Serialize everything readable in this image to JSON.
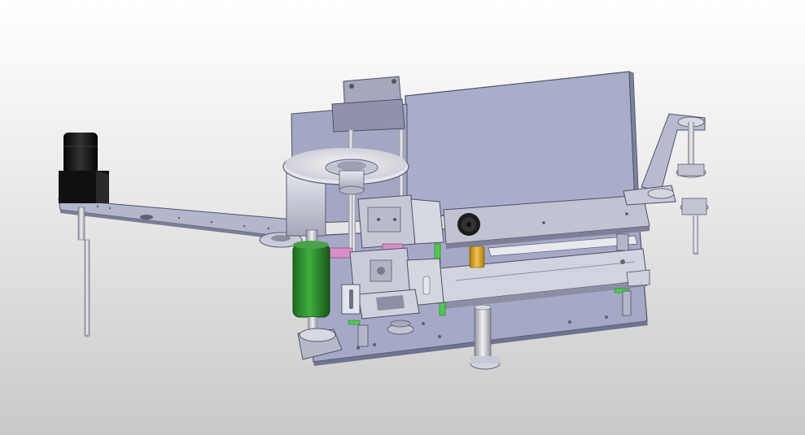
{
  "viewport": {
    "background_top": "#ffffff",
    "background_bottom": "#c9c9c9"
  },
  "model": {
    "colors": {
      "plate": "#a9adc9",
      "plate_edge": "#5b5f78",
      "metal": "#c7c9d6",
      "metal_dark": "#8a8da0",
      "steel": "#dcdde4",
      "green_roller": "#2e8b2e",
      "green_light": "#4fc94f",
      "black_motor": "#151515",
      "gold": "#d6a32a",
      "pink": "#d98fc8",
      "knob": "#1c1c1c"
    }
  }
}
